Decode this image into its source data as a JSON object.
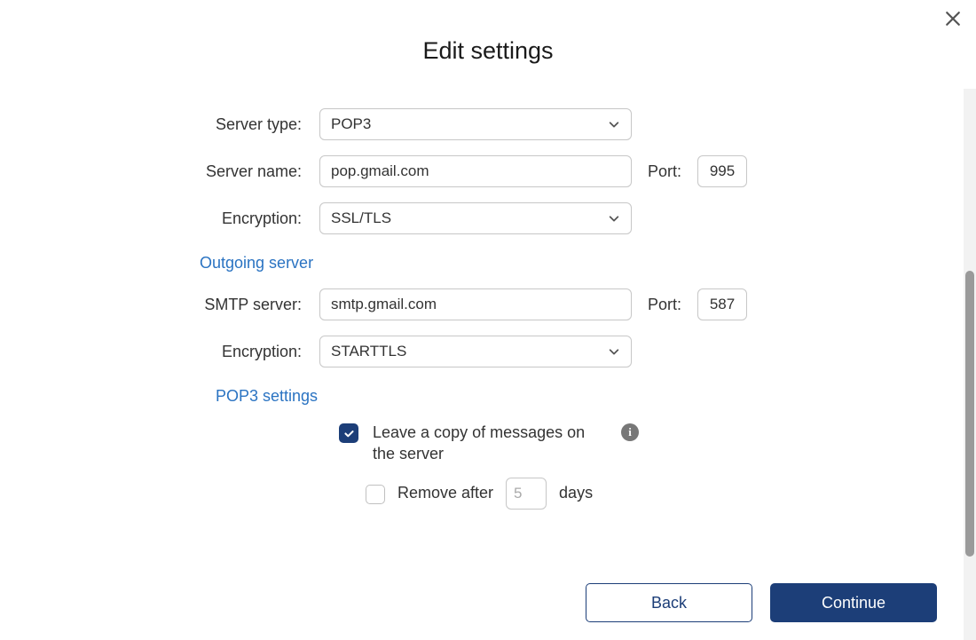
{
  "title": "Edit settings",
  "incoming": {
    "server_type_label": "Server type:",
    "server_type_value": "POP3",
    "server_name_label": "Server name:",
    "server_name_value": "pop.gmail.com",
    "port_label": "Port:",
    "port_value": "995",
    "encryption_label": "Encryption:",
    "encryption_value": "SSL/TLS"
  },
  "outgoing": {
    "heading": "Outgoing server",
    "smtp_label": "SMTP server:",
    "smtp_value": "smtp.gmail.com",
    "port_label": "Port:",
    "port_value": "587",
    "encryption_label": "Encryption:",
    "encryption_value": "STARTTLS"
  },
  "pop3": {
    "heading": "POP3 settings",
    "leave_copy_label": "Leave a copy of messages on the server",
    "remove_after_label": "Remove after",
    "remove_after_value": "5",
    "days_label": "days"
  },
  "buttons": {
    "back": "Back",
    "continue": "Continue"
  }
}
